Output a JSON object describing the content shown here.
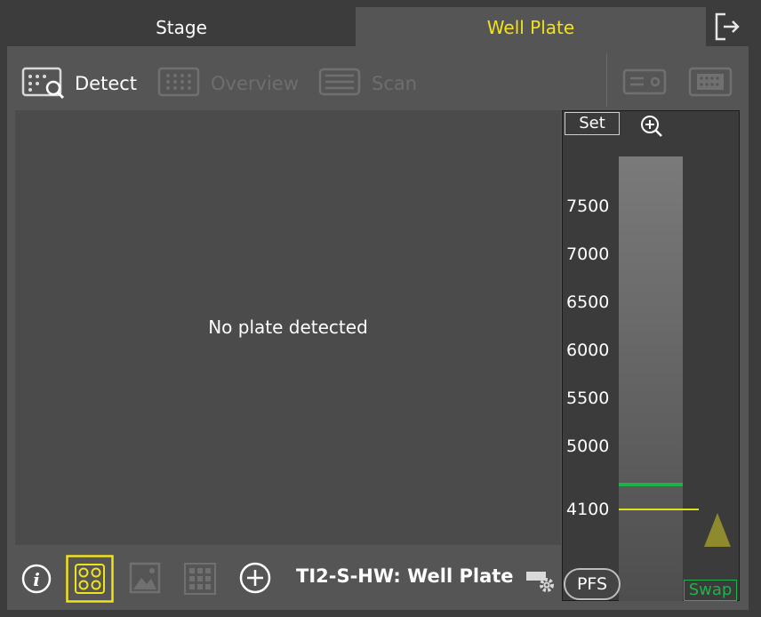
{
  "tabs": [
    {
      "label": "Stage",
      "active": false
    },
    {
      "label": "Well Plate",
      "active": true
    }
  ],
  "toolbar": {
    "items": [
      {
        "label": "Detect",
        "icon": "detect-icon",
        "enabled": true
      },
      {
        "label": "Overview",
        "icon": "overview-icon",
        "enabled": false
      },
      {
        "label": "Scan",
        "icon": "scan-icon",
        "enabled": false
      }
    ],
    "right_icons": [
      "slide-icon",
      "well-plate-icon"
    ]
  },
  "main": {
    "message": "No plate detected"
  },
  "focus": {
    "set_label": "Set",
    "ticks": [
      "7500",
      "7000",
      "6500",
      "6000",
      "5500",
      "5000",
      "4100"
    ],
    "pfs_label": "PFS",
    "swap_label": "Swap"
  },
  "bottom": {
    "status_text": "TI2-S-HW: Well Plate",
    "icons": [
      "info-icon",
      "plate-view-icon",
      "image-icon",
      "grid-icon",
      "add-icon",
      "settings-icon"
    ]
  },
  "colors": {
    "accent": "#f0e21b",
    "green": "#1fb24a",
    "panel": "#555555",
    "background": "#3c3c3c"
  }
}
